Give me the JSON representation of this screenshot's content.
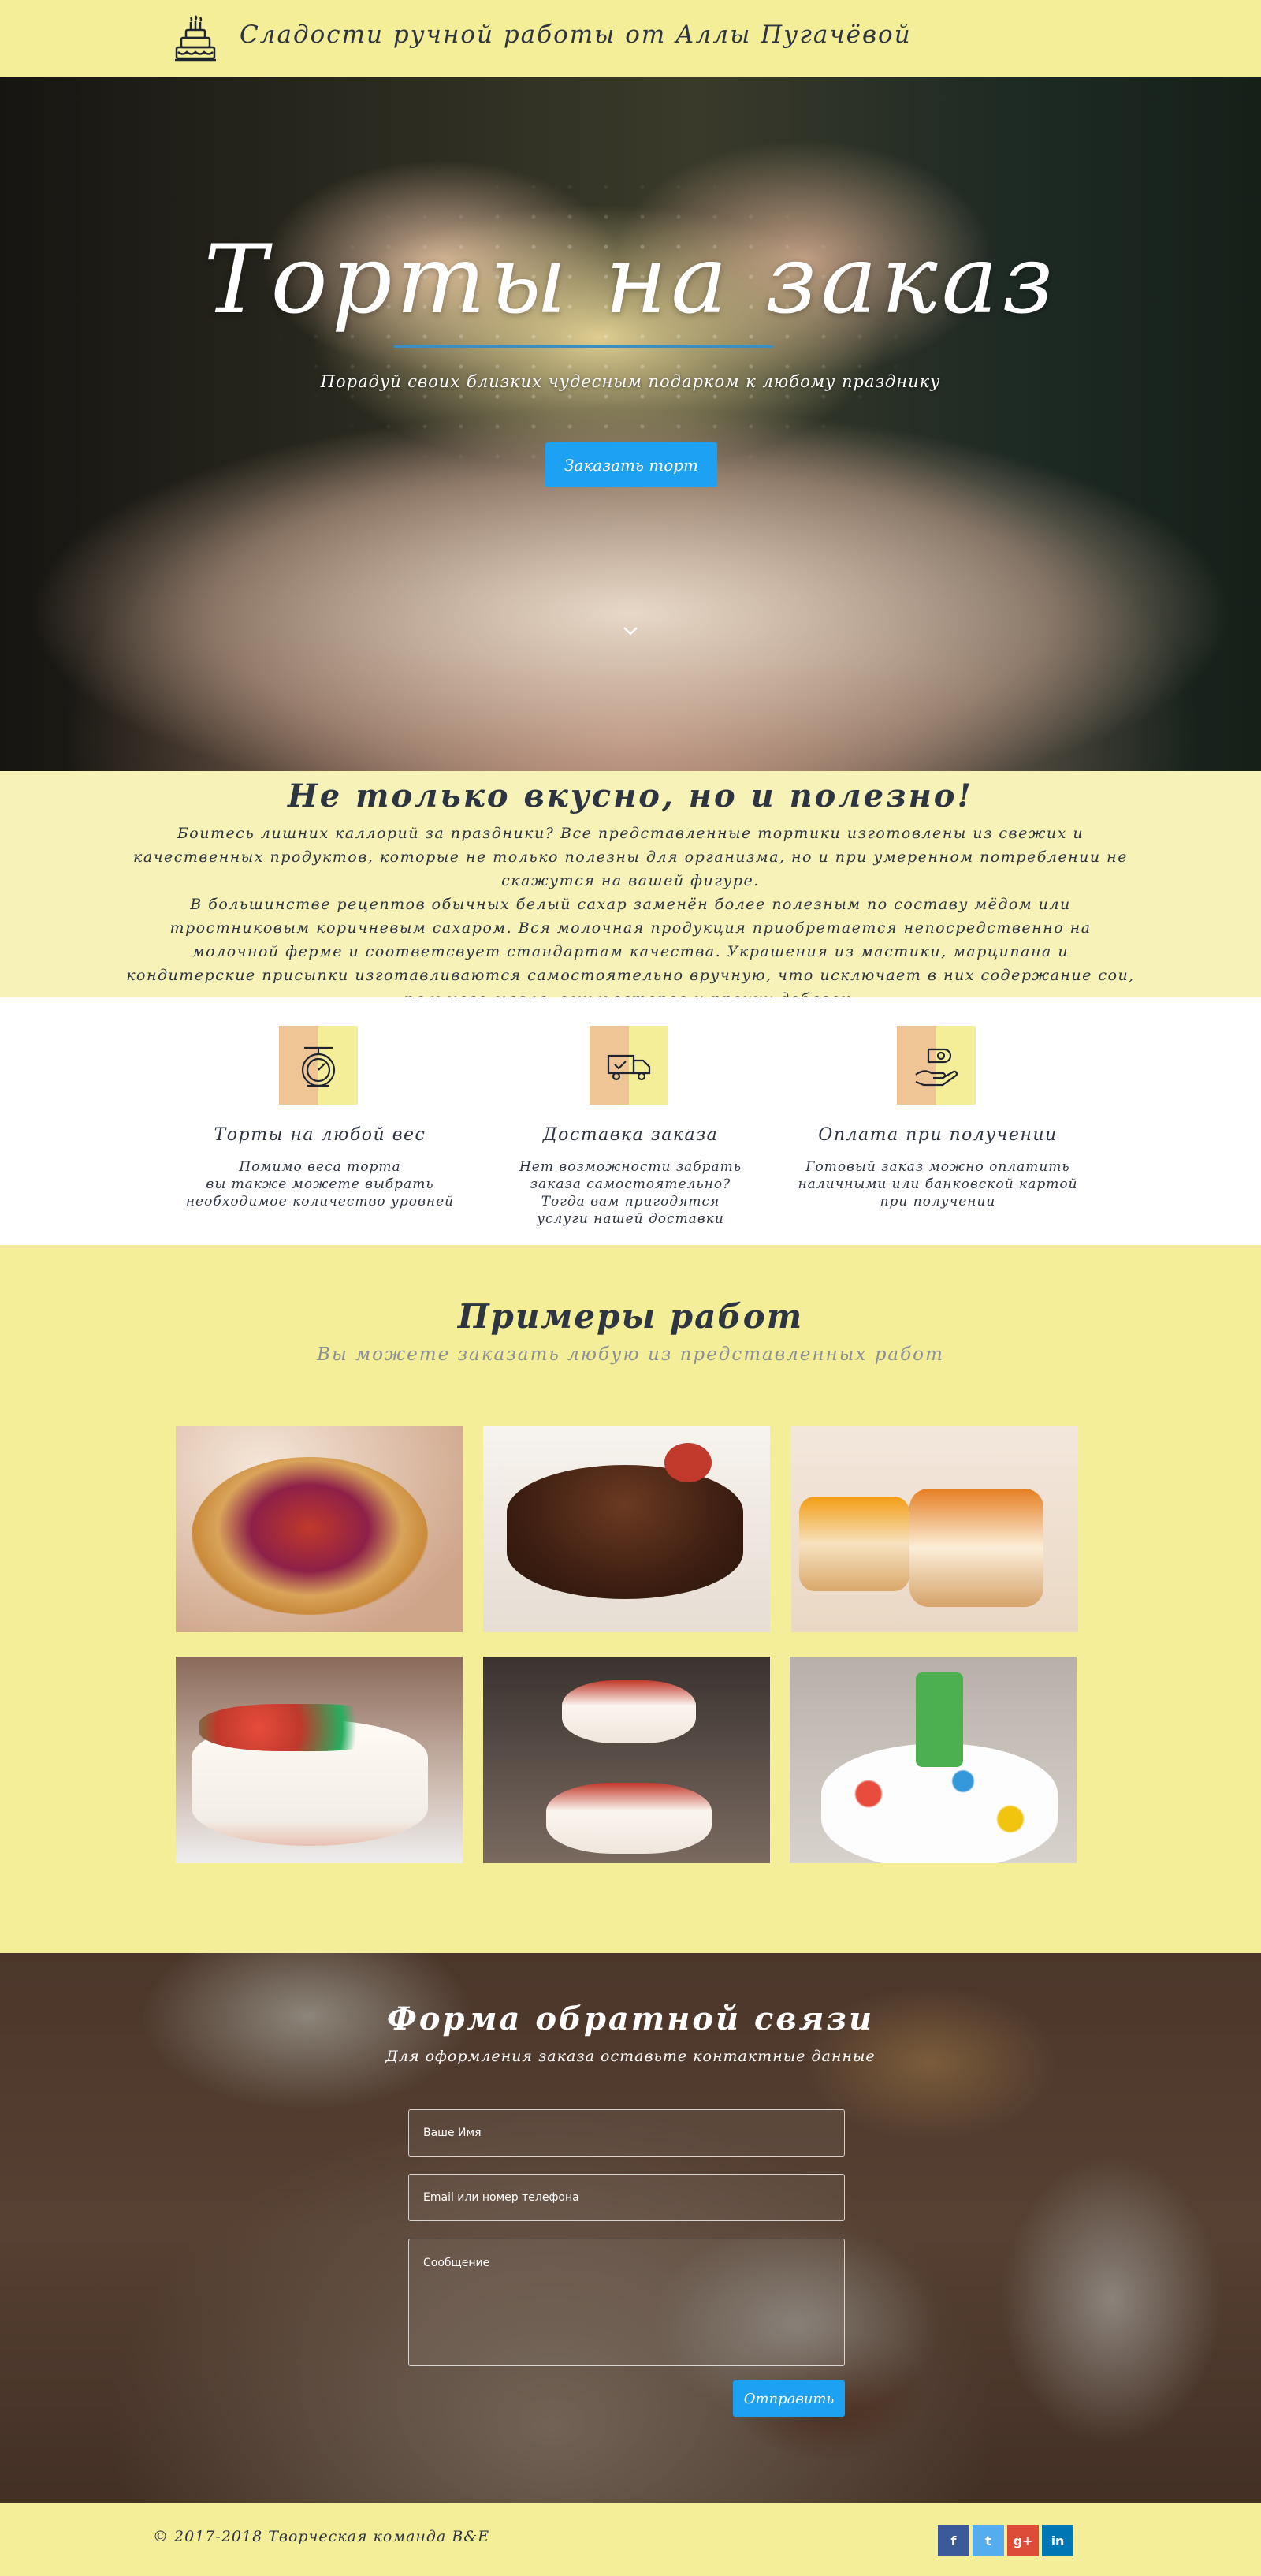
{
  "header": {
    "brand": "Сладости ручной работы от Аллы Пугачёвой",
    "logo_icon": "cake-icon"
  },
  "hero": {
    "title": "Торты на заказ",
    "subtitle": "Порадуй своих близких чудесным подарком к любому празднику",
    "cta_label": "Заказать торт",
    "scroll_icon": "chevron-down-icon"
  },
  "about": {
    "title": "Не только вкусно, но и полезно!",
    "paragraph1": "Боитесь лишних каллорий за праздники? Все представленные тортики изготовлены из свежих и качественных продуктов, которые не только полезны для организма, но и при умеренном потреблении не скажутся на вашей фигуре.",
    "paragraph2": "В большинстве рецептов обычных белый сахар заменён более полезным по составу мёдом или тростниковым коричневым сахаром. Вся молочная продукция приобретается непосредственно на молочной ферме и соответсвует стандартам качества. Украшения из мастики, марципана и кондитерские присыпки изготавливаются самостоятельно вручную, что исключает в них содержание сои, пальмого масла, эмульгаторов и прочих добавок."
  },
  "features": [
    {
      "icon": "scale-icon",
      "title": "Торты на любой вес",
      "text": "Помимо веса торта\nвы также можете выбрать\nнеобходимое количество уровней"
    },
    {
      "icon": "delivery-truck-icon",
      "title": "Доставка заказа",
      "text": "Нет возможности забрать\nзаказа самостоятельно?\nТогда вам пригодятся\nуслуги нашей доставки"
    },
    {
      "icon": "payment-hand-icon",
      "title": "Оплата при получении",
      "text": "Готовый заказ можно оплатить\nналичными или банковской картой\nпри получении"
    }
  ],
  "works": {
    "title": "Примеры работ",
    "subtitle": "Вы можете заказать любую из представленных работ",
    "items": [
      "berry-tart-photo",
      "chocolate-cake-photo",
      "cheesecakes-photo",
      "flower-cake-photo",
      "tiered-berry-cake-photo",
      "birthday-cake-photo"
    ]
  },
  "contact": {
    "title": "Форма обратной связи",
    "subtitle": "Для оформления заказа оставьте контактные данные",
    "name_placeholder": "Ваше Имя",
    "email_placeholder": "Email или номер телефона",
    "message_placeholder": "Сообщение",
    "send_label": "Отправить"
  },
  "footer": {
    "copyright": "© 2017-2018 Творческая команда B&E",
    "social": [
      {
        "icon": "facebook-icon",
        "glyph": "f",
        "color": "#3b5998"
      },
      {
        "icon": "twitter-icon",
        "glyph": "t",
        "color": "#55acee"
      },
      {
        "icon": "google-plus-icon",
        "glyph": "g+",
        "color": "#dd4b39"
      },
      {
        "icon": "linkedin-icon",
        "glyph": "in",
        "color": "#0077b5"
      }
    ]
  },
  "colors": {
    "accent_blue": "#1da1f2",
    "header_yellow": "#f4ee98",
    "text_dark": "#2d3442"
  }
}
